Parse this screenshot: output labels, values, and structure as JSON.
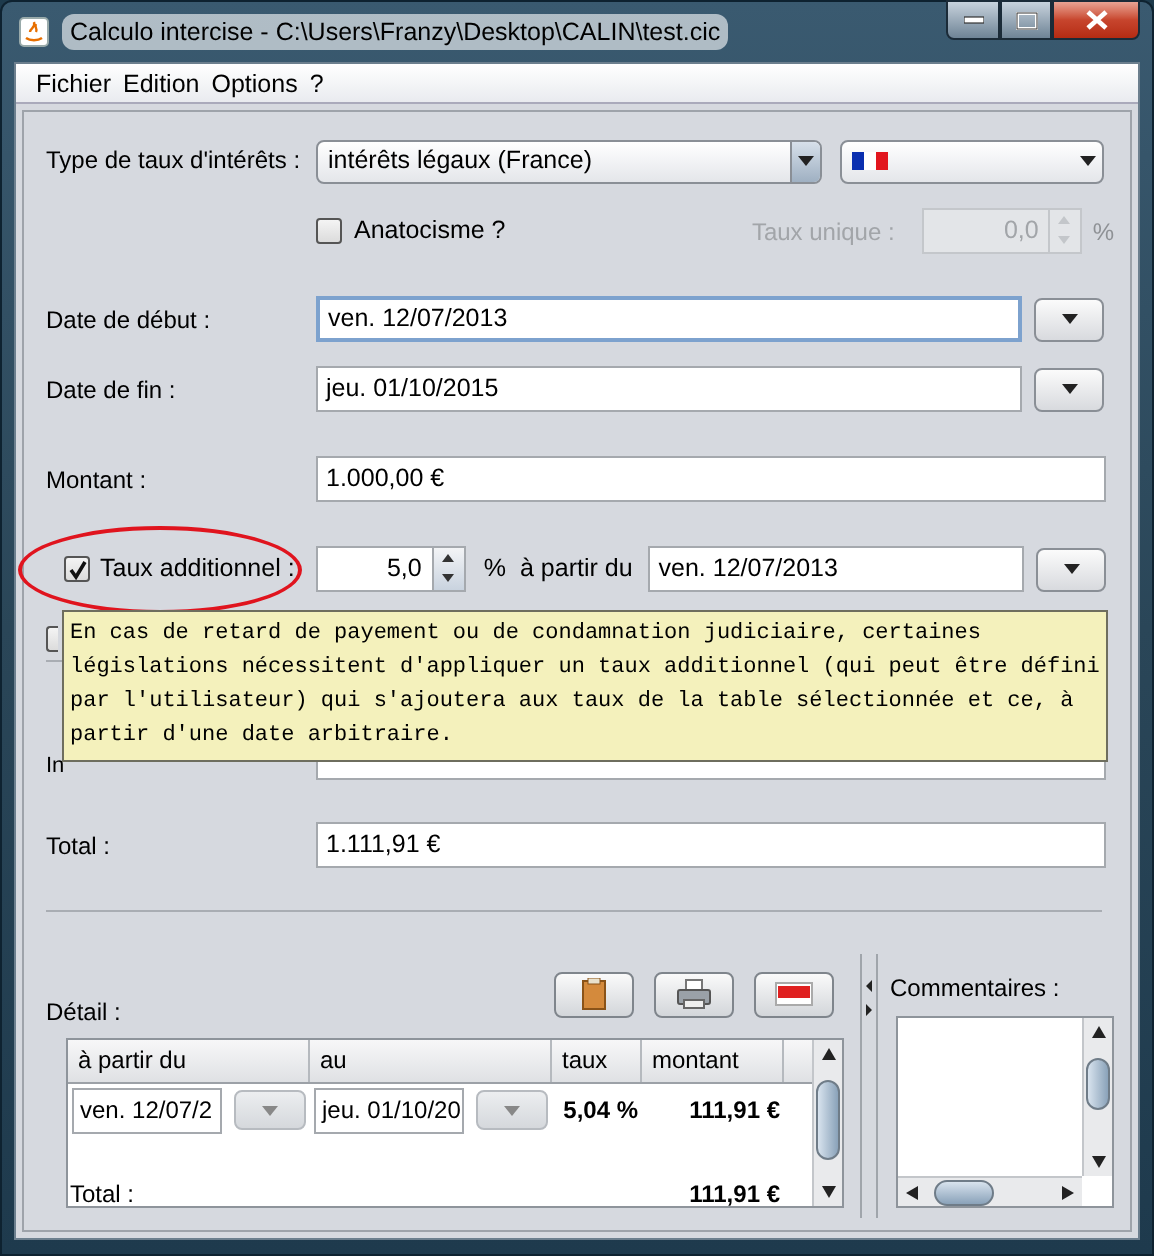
{
  "window": {
    "title": "Calculo intercise - C:\\Users\\Franzy\\Desktop\\CALIN\\test.cic"
  },
  "menu": [
    "Fichier",
    "Edition",
    "Options",
    "?"
  ],
  "rate_type": {
    "label": "Type de taux d'intérêts :",
    "value": "intérêts légaux (France)"
  },
  "anatocisme": {
    "label": "Anatocisme ?",
    "checked": false
  },
  "single_rate": {
    "label": "Taux unique :",
    "value": "0,0",
    "unit": "%",
    "disabled": true
  },
  "start_date": {
    "label": "Date de début :",
    "value": "ven. 12/07/2013",
    "focused": true
  },
  "end_date": {
    "label": "Date de fin :",
    "value": "jeu. 01/10/2015",
    "focused": false
  },
  "amount": {
    "label": "Montant :",
    "value": "1.000,00 €"
  },
  "additional_rate": {
    "label": "Taux additionnel :",
    "checked": true,
    "value": "5,0",
    "unit": "%",
    "from_label": "à partir du",
    "from_value": "ven. 12/07/2013"
  },
  "tooltip": "En cas de retard de payement ou de condamnation judiciaire, certaines législations nécessitent d'appliquer un taux additionnel (qui peut être défini par l'utilisateur) qui s'ajoutera aux taux de la table sélectionnée et ce, à partir d'une date arbitraire.",
  "option": {
    "checked": false
  },
  "interest": {
    "label": "In"
  },
  "total": {
    "label": "Total :",
    "value": "1.111,91 €"
  },
  "detail": {
    "label": "Détail :",
    "columns": [
      "à partir du",
      "au",
      "taux",
      "montant"
    ],
    "rows": [
      {
        "from": "ven. 12/07/2",
        "to": "jeu. 01/10/20",
        "rate": "5,04 %",
        "amount": "111,91 €"
      }
    ],
    "total": {
      "label": "Total :",
      "value": "111,91 €"
    }
  },
  "comments": {
    "label": "Commentaires :"
  }
}
